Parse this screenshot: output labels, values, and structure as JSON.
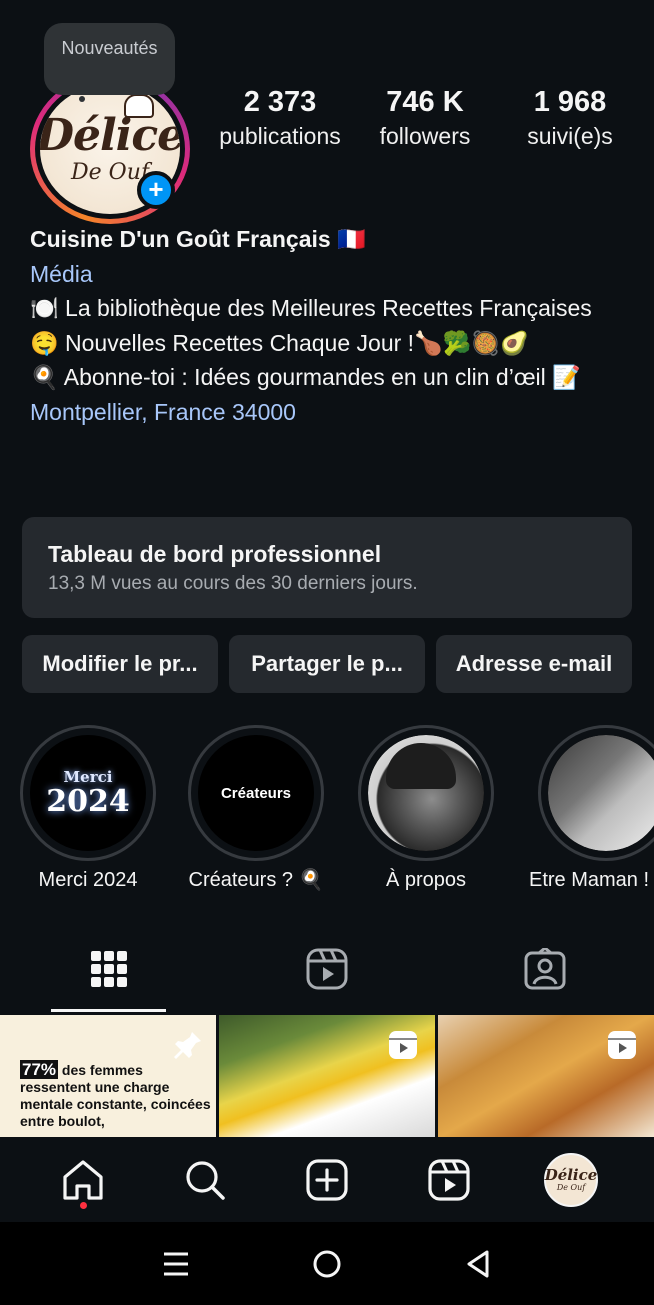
{
  "tooltip": {
    "text": "Nouveautés"
  },
  "profile": {
    "avatar_logo": "Délice",
    "avatar_logo_sub": "De Ouf",
    "stats": [
      {
        "value": "2 373",
        "label": "publications"
      },
      {
        "value": "746 K",
        "label": "followers"
      },
      {
        "value": "1 968",
        "label": "suivi(e)s"
      }
    ]
  },
  "bio": {
    "name": "Cuisine D'un Goût Français 🇫🇷",
    "category": "Média",
    "line1": "🍽️ La bibliothèque des Meilleures Recettes Françaises",
    "line2": "🤤 Nouvelles Recettes Chaque Jour !🍗🥦🥘🥑",
    "line3": "🍳 Abonne-toi : Idées gourmandes en un clin d’œil 📝",
    "location": "Montpellier, France 34000"
  },
  "dashboard": {
    "title": "Tableau de bord professionnel",
    "subtitle": "13,3 M vues au cours des 30 derniers jours."
  },
  "buttons": {
    "edit": "Modifier le pr...",
    "share": "Partager le p...",
    "email": "Adresse e-mail"
  },
  "highlights": [
    {
      "label": "Merci 2024",
      "top": "Merci",
      "year": "2024"
    },
    {
      "label": "Créateurs ? 🍳",
      "inner": "Créateurs"
    },
    {
      "label": "À propos"
    },
    {
      "label": "Etre Maman !"
    }
  ],
  "grid": {
    "tile1_pct": "77%",
    "tile1_text": "des femmes ressentent une charge mentale constante, coincées entre boulot,"
  },
  "colors": {
    "background": "#0c1014",
    "link": "#a8c7fa",
    "accent": "#0095f6",
    "card": "#25292e",
    "notification": "#ff3040"
  }
}
